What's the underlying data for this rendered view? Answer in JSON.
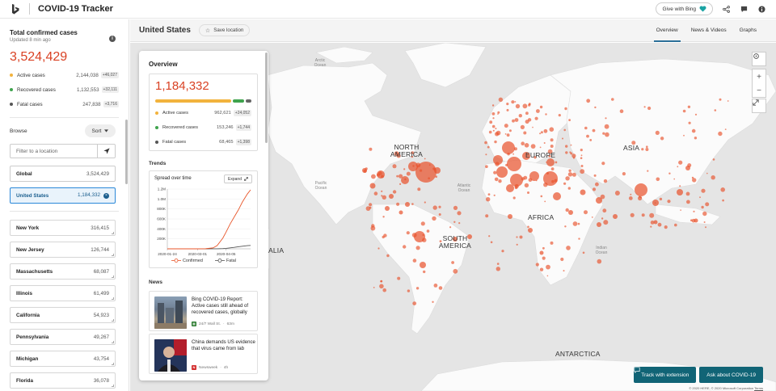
{
  "app": {
    "title": "COVID-19 Tracker",
    "give_label": "Give with Bing"
  },
  "sidebar": {
    "title": "Total confirmed cases",
    "updated": "Updated 8 min ago",
    "total": "3,524,429",
    "stats": [
      {
        "label": "Active cases",
        "value": "2,144,038",
        "delta": "+46,027",
        "color": "#f2b33d"
      },
      {
        "label": "Recovered cases",
        "value": "1,132,553",
        "delta": "+32,111",
        "color": "#3fa34d"
      },
      {
        "label": "Fatal cases",
        "value": "247,838",
        "delta": "+3,716",
        "color": "#555555"
      }
    ],
    "browse_label": "Browse",
    "sort_label": "Sort",
    "filter_placeholder": "Filter to a location",
    "global": {
      "name": "Global",
      "value": "3,524,429"
    },
    "selected": {
      "name": "United States",
      "value": "1,184,332"
    },
    "states": [
      {
        "name": "New York",
        "value": "316,415"
      },
      {
        "name": "New Jersey",
        "value": "126,744"
      },
      {
        "name": "Massachusetts",
        "value": "68,087"
      },
      {
        "name": "Illinois",
        "value": "61,499"
      },
      {
        "name": "California",
        "value": "54,923"
      },
      {
        "name": "Pennsylvania",
        "value": "49,267"
      },
      {
        "name": "Michigan",
        "value": "43,754"
      },
      {
        "name": "Florida",
        "value": "36,078"
      }
    ]
  },
  "header": {
    "location": "United States",
    "save_label": "Save location",
    "tabs": [
      "Overview",
      "News & Videos",
      "Graphs"
    ]
  },
  "panel": {
    "title": "Overview",
    "total": "1,184,332",
    "stats": [
      {
        "label": "Active cases",
        "value": "962,621",
        "delta": "+24,052",
        "color": "#f2b33d"
      },
      {
        "label": "Recovered cases",
        "value": "153,246",
        "delta": "+1,744",
        "color": "#3fa34d"
      },
      {
        "label": "Fatal cases",
        "value": "68,465",
        "delta": "+1,398",
        "color": "#555555"
      }
    ],
    "trends_label": "Trends",
    "chart_title": "Spread over time",
    "expand_label": "Expand",
    "news_label": "News",
    "news": [
      {
        "headline": "Bing COVID-19 Report: Active cases still ahead of recovered cases, globally",
        "source": "24/7 Wall St.",
        "age": "63m",
        "icon": "stock-building-icon"
      },
      {
        "headline": "China demands US evidence that virus came from lab",
        "source": "Newsweek",
        "age": "4h",
        "icon": "newsweek-icon"
      }
    ]
  },
  "chart_data": {
    "type": "line",
    "x": [
      "2020-01-24",
      "2020-02-01",
      "2020-02-15",
      "2020-03-01",
      "2020-03-10",
      "2020-03-20",
      "2020-03-25",
      "2020-04-01",
      "2020-04-05",
      "2020-04-10",
      "2020-04-15",
      "2020-04-20",
      "2020-04-25",
      "2020-05-01",
      "2020-05-05"
    ],
    "x_ticks": [
      "2020-01-24",
      "2020-03-01",
      "2020-04-05"
    ],
    "y_ticks": [
      "200K",
      "400K",
      "600K",
      "800K",
      "1.0M",
      "1.2M"
    ],
    "ylim": [
      0,
      1200000
    ],
    "series": [
      {
        "name": "Confirmed",
        "color": "#e8562a",
        "values": [
          1,
          8,
          15,
          75,
          1000,
          19000,
          65000,
          215000,
          337000,
          500000,
          640000,
          780000,
          940000,
          1100000,
          1184332
        ]
      },
      {
        "name": "Fatal",
        "color": "#555555",
        "values": [
          0,
          0,
          0,
          1,
          30,
          250,
          950,
          5100,
          9600,
          18500,
          28500,
          42000,
          52000,
          63000,
          68465
        ]
      }
    ]
  },
  "map": {
    "continent_labels": [
      "NORTH AMERICA",
      "EUROPE",
      "ASIA",
      "AFRICA",
      "SOUTH AMERICA",
      "ANTARCTICA",
      "ALIA"
    ],
    "ocean_labels": [
      "Arctic Ocean",
      "Pacific Ocean",
      "Atlantic Ocean",
      "Indian Ocean"
    ],
    "track_label": "Track with extension",
    "ask_label": "Ask about COVID-19",
    "copyright": "© 2020 HERE, © 2020 Microsoft Corporation",
    "terms": "Terms"
  }
}
